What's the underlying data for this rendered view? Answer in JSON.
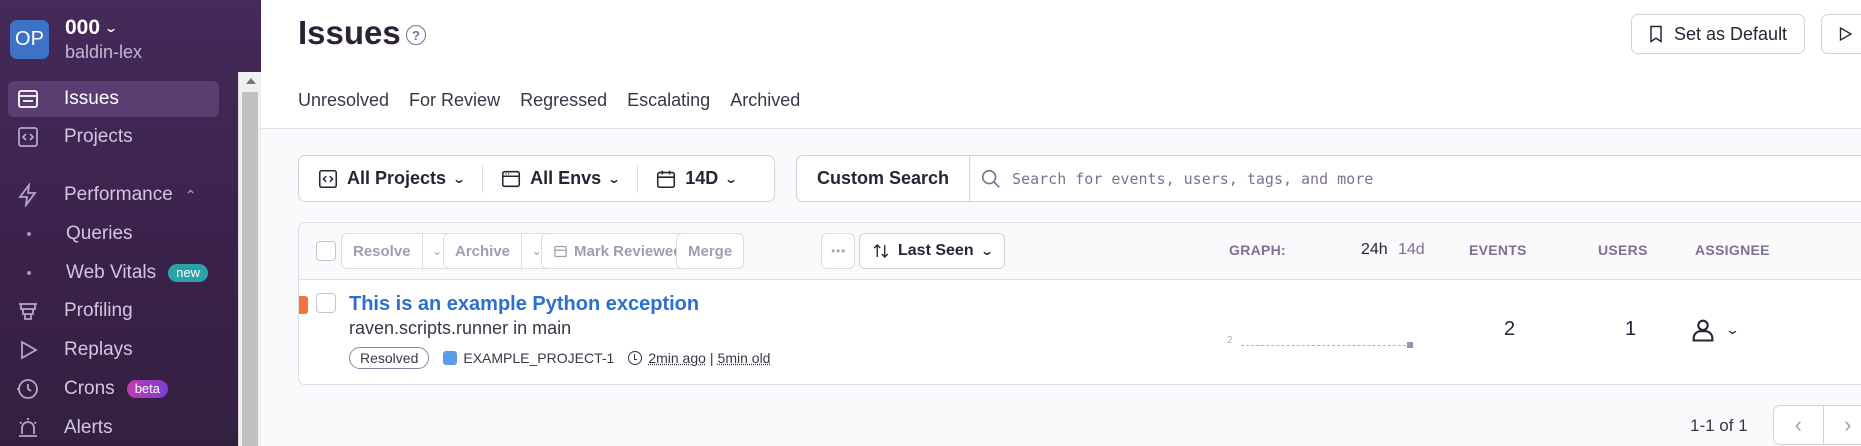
{
  "org": {
    "avatar": "OP",
    "name": "000",
    "subtitle": "baldin-lex"
  },
  "sidebar": {
    "items": [
      {
        "label": "Issues",
        "icon": "issues-icon",
        "active": true
      },
      {
        "label": "Projects",
        "icon": "projects-icon"
      },
      {
        "label": "Performance",
        "icon": "performance-icon"
      },
      {
        "label": "Queries"
      },
      {
        "label": "Web Vitals",
        "badge": "new"
      },
      {
        "label": "Profiling",
        "icon": "profiling-icon"
      },
      {
        "label": "Replays",
        "icon": "replays-icon"
      },
      {
        "label": "Crons",
        "icon": "crons-icon",
        "badge": "beta"
      },
      {
        "label": "Alerts",
        "icon": "alerts-icon"
      }
    ]
  },
  "header": {
    "title": "Issues",
    "help": "?",
    "set_default_label": "Set as Default"
  },
  "tabs": [
    "Unresolved",
    "For Review",
    "Regressed",
    "Escalating",
    "Archived"
  ],
  "filters": {
    "projects": "All Projects",
    "envs": "All Envs",
    "period": "14D",
    "custom_search": "Custom Search",
    "search_placeholder": "Search for events, users, tags, and more"
  },
  "actions": {
    "resolve": "Resolve",
    "archive": "Archive",
    "mark_reviewed": "Mark Reviewed",
    "merge": "Merge",
    "more": "⋯",
    "sort": "Last Seen"
  },
  "columns": {
    "graph": "GRAPH:",
    "period_24h": "24h",
    "period_14d": "14d",
    "events": "EVENTS",
    "users": "USERS",
    "assignee": "ASSIGNEE"
  },
  "issues": [
    {
      "title": "This is an example Python exception",
      "culprit": "raven.scripts.runner in main",
      "status": "Resolved",
      "project": "EXAMPLE_PROJECT-1",
      "last_seen": "2min ago",
      "age": "5min old",
      "graph_max": "2",
      "events": "2",
      "users": "1"
    }
  ],
  "pagination": {
    "text": "1-1 of 1",
    "prev": "‹",
    "next": "›"
  },
  "colors": {
    "sidebar": "#3a2149",
    "link": "#2b6fcf",
    "accent_bar": "#f0763d",
    "badge_new": "#2ba1a8"
  }
}
